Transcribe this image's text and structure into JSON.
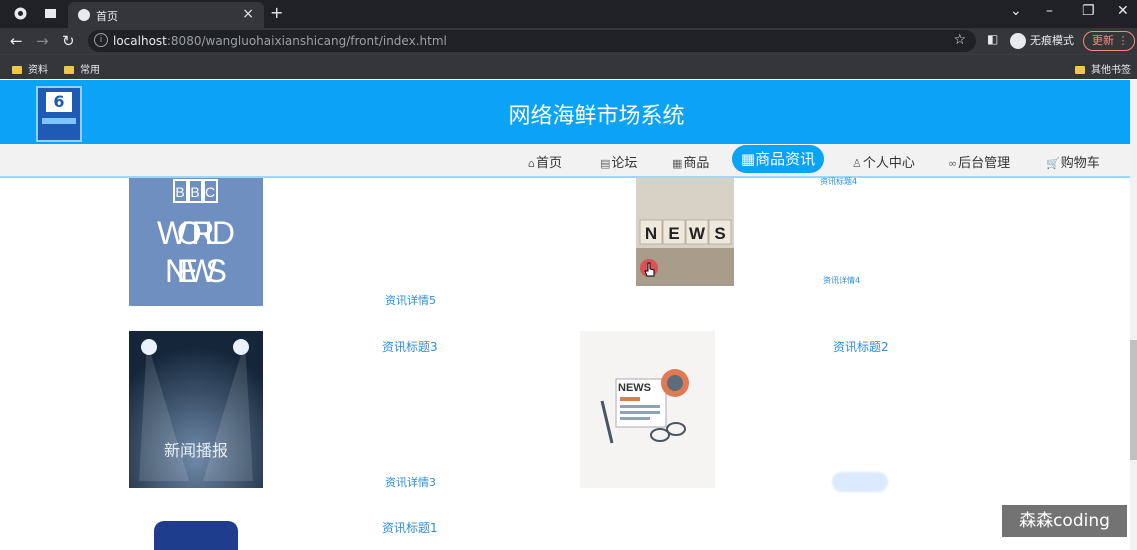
{
  "browser": {
    "tab_title": "首页",
    "url_host": "localhost",
    "url_rest": ":8080/wangluohaixianshicang/front/index.html",
    "incognito_label": "无痕模式",
    "update_label": "更新",
    "bookmarks": [
      "资料",
      "常用"
    ],
    "other_bookmarks": "其他书签"
  },
  "site": {
    "title": "网络海鲜市场系统",
    "nav": [
      "首页",
      "论坛",
      "商品",
      "商品资讯",
      "个人中心",
      "后台管理",
      "购物车"
    ]
  },
  "news": {
    "items": [
      {
        "thumb": "BBC WORLD NEWS",
        "detail": "资讯详情5"
      },
      {
        "thumb": "NEWS",
        "title": "资讯标题4",
        "detail": "资讯详情4"
      },
      {
        "thumb": "新闻播报",
        "title": "资讯标题3",
        "detail": "资讯详情3"
      },
      {
        "thumb": "NEWS",
        "title": "资讯标题2"
      },
      {
        "title": "资讯标题1"
      }
    ]
  },
  "watermark": "森森coding",
  "colors": {
    "header": "#0aa3f5",
    "link": "#2b8fe0"
  }
}
